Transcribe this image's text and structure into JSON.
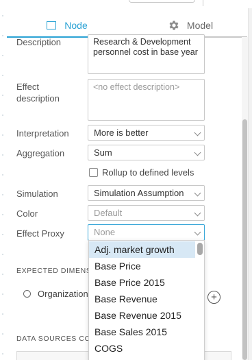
{
  "tabs": {
    "node": "Node",
    "model": "Model"
  },
  "form": {
    "description": {
      "label": "Description",
      "value": "Research & Development personnel cost in base year"
    },
    "effect_description": {
      "label": "Effect description",
      "placeholder": "<no effect description>"
    },
    "interpretation": {
      "label": "Interpretation",
      "value": "More is better"
    },
    "aggregation": {
      "label": "Aggregation",
      "value": "Sum"
    },
    "rollup": {
      "label": "Rollup to defined levels",
      "checked": false
    },
    "simulation": {
      "label": "Simulation",
      "value": "Simulation Assumption"
    },
    "color": {
      "label": "Color",
      "value": "Default"
    },
    "effect_proxy": {
      "label": "Effect Proxy",
      "value": "None"
    }
  },
  "sections": {
    "expected_dimensions": "EXPECTED DIMENS",
    "organization": "Organization",
    "data_sources": "DATA SOURCES CO"
  },
  "dropdown": {
    "items": [
      "Adj. market growth",
      "Base Price",
      "Base Price 2015",
      "Base Revenue",
      "Base Revenue 2015",
      "Base Sales 2015",
      "COGS"
    ],
    "hovered_index": 0
  },
  "colors": {
    "accent": "#2aa2d4",
    "hover": "#d7e8f5"
  }
}
